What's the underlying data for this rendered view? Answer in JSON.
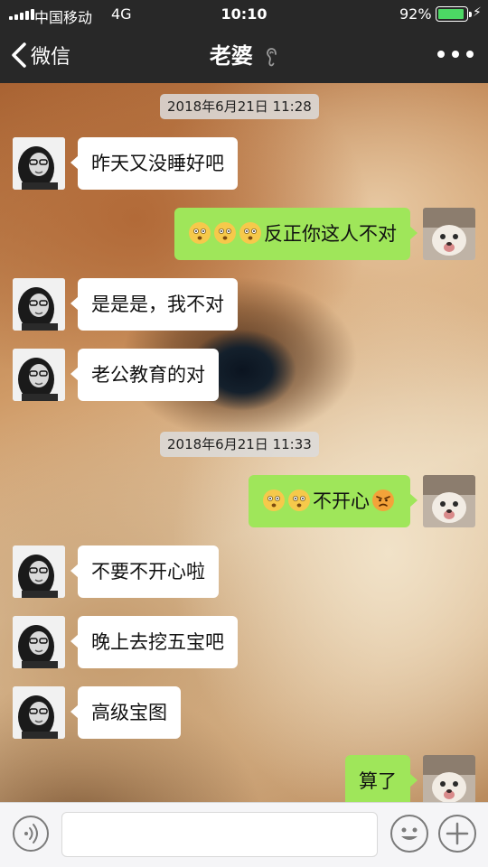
{
  "status_bar": {
    "carrier": "中国移动",
    "network": "4G",
    "time": "10:10",
    "battery_percent": "92%",
    "battery_level": 0.92
  },
  "nav": {
    "back_label": "微信",
    "title": "老婆",
    "title_icon": "ear-icon",
    "more_icon": "more-dots-icon"
  },
  "chat": {
    "timestamps": [
      "2018年6月21日 11:28",
      "2018年6月21日 11:33"
    ],
    "messages": [
      {
        "sender": "her",
        "text": "昨天又没睡好吧"
      },
      {
        "sender": "me",
        "emoji": [
          "flushed-emoji",
          "flushed-emoji",
          "flushed-emoji"
        ],
        "text": "反正你这人不对"
      },
      {
        "sender": "her",
        "text": "是是是，我不对"
      },
      {
        "sender": "her",
        "text": "老公教育的对"
      },
      {
        "sender": "me",
        "emoji": [
          "flushed-emoji",
          "flushed-emoji"
        ],
        "text": "不开心",
        "emoji_after": "angry-emoji"
      },
      {
        "sender": "her",
        "text": "不要不开心啦"
      },
      {
        "sender": "her",
        "text": "晚上去挖五宝吧"
      },
      {
        "sender": "her",
        "text": "高级宝图"
      },
      {
        "sender": "me",
        "text": "算了"
      }
    ]
  },
  "input_bar": {
    "voice_icon": "voice-icon",
    "text_value": "",
    "emoji_icon": "emoji-icon",
    "plus_icon": "plus-icon"
  },
  "colors": {
    "nav_bg": "#282828",
    "incoming_bubble": "#ffffff",
    "outgoing_bubble": "#9fe65a",
    "battery_green": "#4cd964"
  }
}
